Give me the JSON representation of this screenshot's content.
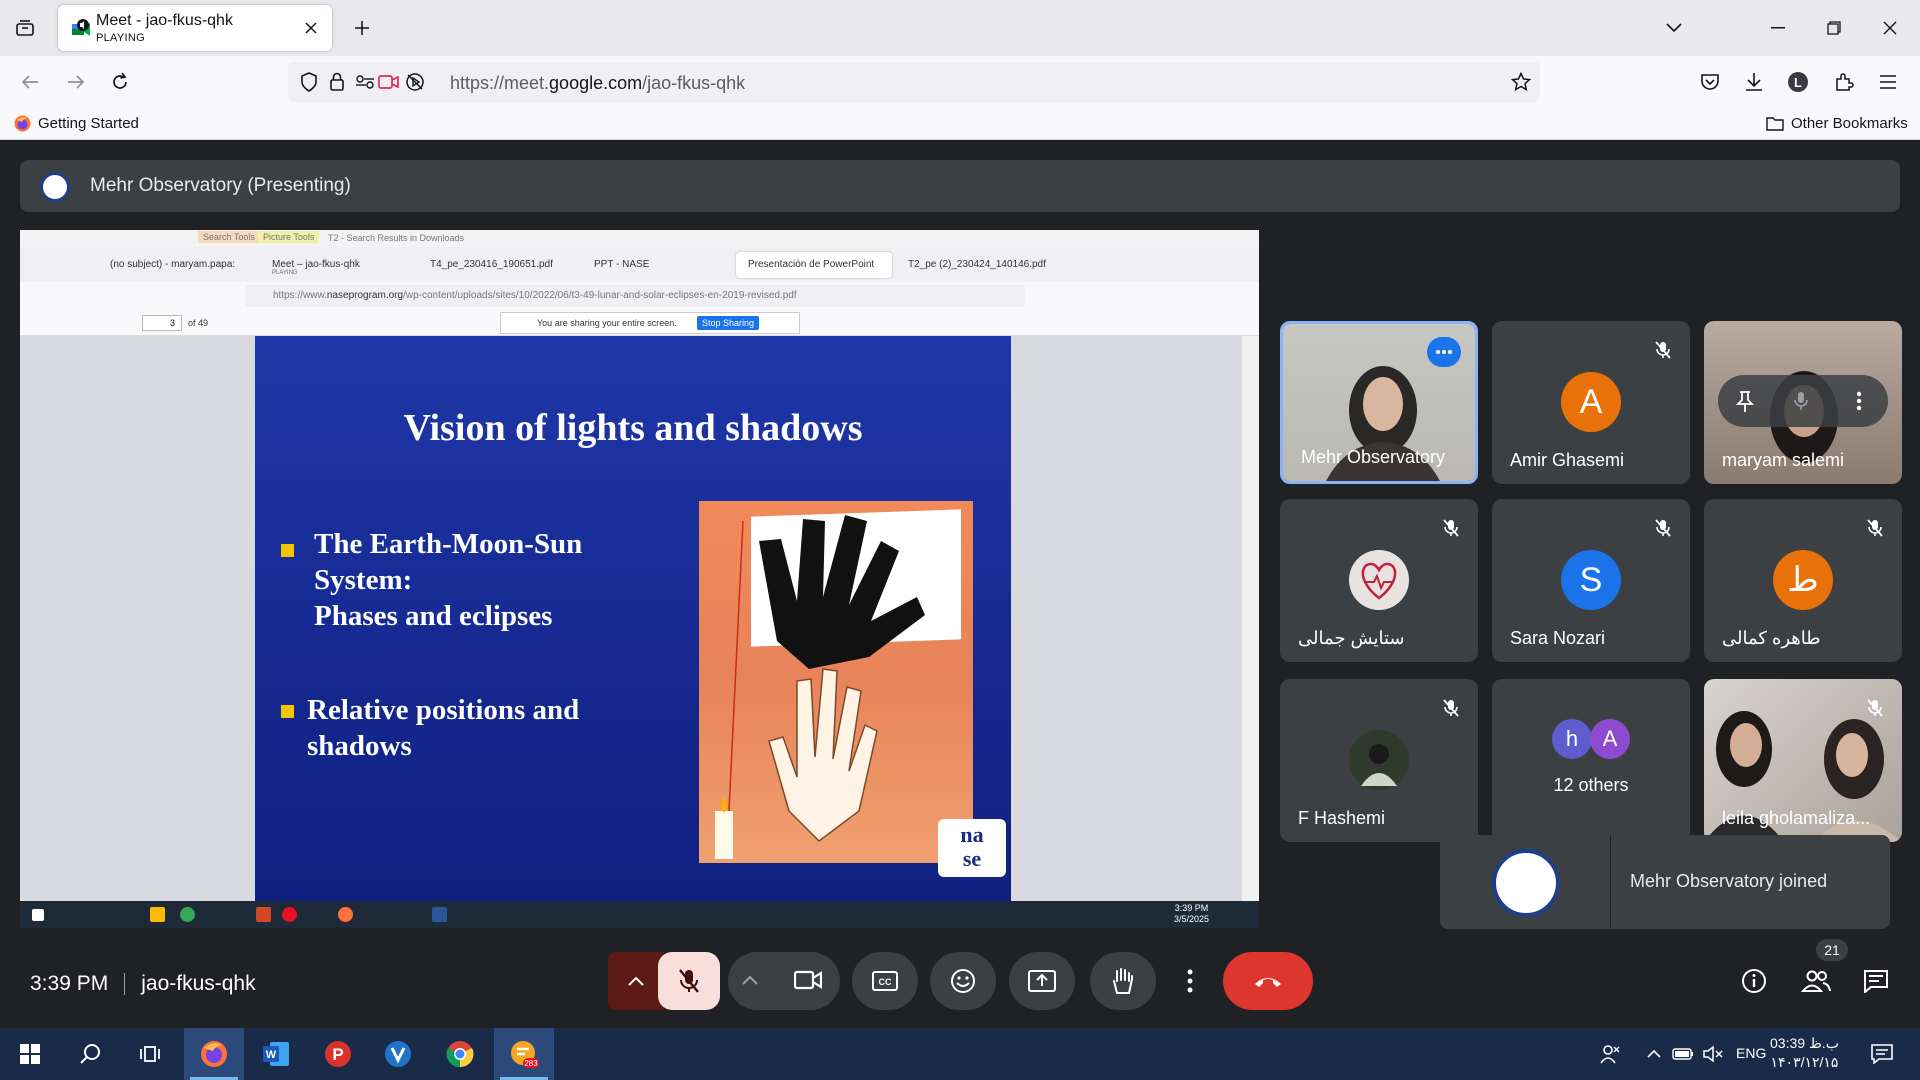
{
  "browser": {
    "tab": {
      "title": "Meet - jao-fkus-qhk",
      "subtitle": "PLAYING"
    },
    "url_prefix": "https://meet.",
    "url_domain": "google.com",
    "url_path": "/jao-fkus-qhk",
    "bookmark_left": "Getting Started",
    "bookmark_right": "Other Bookmarks"
  },
  "meet": {
    "presenter_label": "Mehr Observatory (Presenting)",
    "time": "3:39 PM",
    "meeting_code": "jao-fkus-qhk",
    "participant_count": "21",
    "toast": "Mehr Observatory joined",
    "tiles": [
      {
        "name": "Mehr Observatory"
      },
      {
        "name": "Amir Ghasemi",
        "initial": "A",
        "color": "#e8710a"
      },
      {
        "name": "maryam salemi"
      },
      {
        "name": "ستایش جمالی"
      },
      {
        "name": "Sara Nozari",
        "initial": "S",
        "color": "#1a73e8"
      },
      {
        "name": "طاهره کمالی",
        "initial": "ط",
        "color": "#e8710a"
      },
      {
        "name": "F Hashemi"
      },
      {
        "name": "12 others",
        "initial1": "h",
        "initial2": "A"
      },
      {
        "name": "leila gholamaliza..."
      }
    ]
  },
  "shared_screen": {
    "top_tabs_label1": "Search Tools",
    "top_tabs_label2": "Picture Tools",
    "top_title": "T2 - Search Results in Downloads",
    "tabs": [
      "(no subject) - maryam.papa:",
      "Meet – jao-fkus-qhk",
      "T4_pe_230416_190651.pdf",
      "PPT - NASE",
      "Presentación de PowerPoint",
      "T2_pe (2)_230424_140146.pdf"
    ],
    "tab_playing": "PLAYING",
    "url_prefix": "https://www.",
    "url_domain": "naseprogram.org",
    "url_path": "/wp-content/uploads/sites/10/2022/06/t3-49-lunar-and-solar-eclipses-en-2019-revised.pdf",
    "page_number": "3",
    "page_of": "of 49",
    "share_notice": "You are sharing your entire screen.",
    "stop_sharing": "Stop Sharing",
    "clock_time": "3:39 PM",
    "clock_date": "3/5/2025",
    "tray_lang": "ENG"
  },
  "slide": {
    "title": "Vision of lights and shadows",
    "bullet1_l1": "The Earth-Moon-Sun",
    "bullet1_l2": "System:",
    "bullet1_l3": "Phases and eclipses",
    "bullet2_l1": "Relative positions and",
    "bullet2_l2": "shadows",
    "logo_l1": "na",
    "logo_l2": "se"
  },
  "windows": {
    "clock_time": "03:39 ب.ظ",
    "clock_date": "۱۴۰۳/۱۲/۱۵",
    "lang": "ENG",
    "badge_count": "283"
  }
}
